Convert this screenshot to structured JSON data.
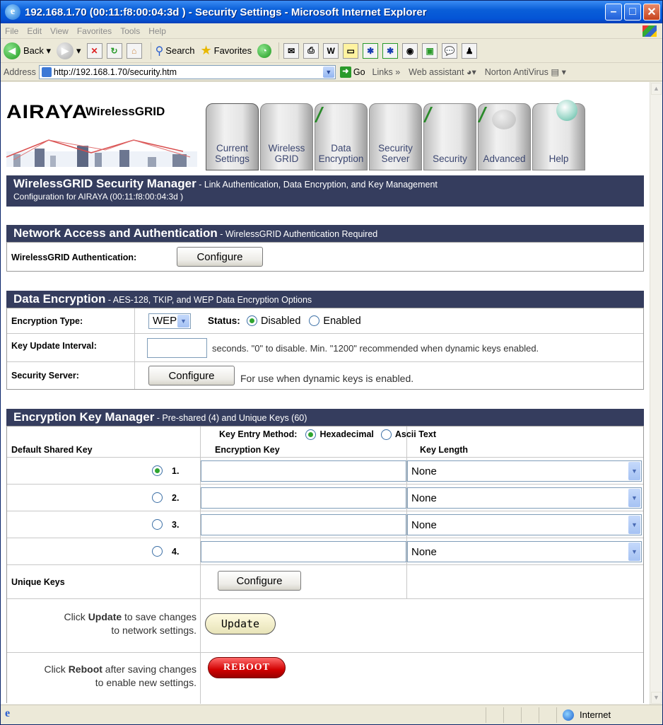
{
  "window": {
    "title": "192.168.1.70 (00:11:f8:00:04:3d ) - Security Settings - Microsoft Internet Explorer"
  },
  "menu": [
    "File",
    "Edit",
    "View",
    "Favorites",
    "Tools",
    "Help"
  ],
  "toolbar": {
    "back": "Back",
    "search": "Search",
    "favorites": "Favorites"
  },
  "addressbar": {
    "label": "Address",
    "url": "http://192.168.1.70/security.htm",
    "go": "Go",
    "links": "Links",
    "web_assistant": "Web assistant",
    "norton": "Norton AntiVirus"
  },
  "logo": {
    "brand": "AIRAYA",
    "product": "WirelessGRID"
  },
  "tabs": [
    {
      "line1": "Current",
      "line2": "Settings"
    },
    {
      "line1": "Wireless",
      "line2": "GRID"
    },
    {
      "line1": "Data",
      "line2": "Encryption"
    },
    {
      "line1": "Security",
      "line2": "Server"
    },
    {
      "line1": "",
      "line2": "Security"
    },
    {
      "line1": "",
      "line2": "Advanced"
    },
    {
      "line1": "",
      "line2": "Help"
    }
  ],
  "banner": {
    "title": "WirelessGRID Security Manager",
    "subtitle": " - Link Authentication, Data Encryption, and Key Management",
    "config": "Configuration for AIRAYA (00:11:f8:00:04:3d )"
  },
  "network_access": {
    "title": "Network Access and Authentication",
    "subtitle": " - WirelessGRID Authentication Required",
    "auth_label": "WirelessGRID Authentication:",
    "configure": "Configure"
  },
  "data_encryption": {
    "title": "Data Encryption",
    "subtitle": " - AES-128, TKIP, and WEP Data Encryption Options",
    "enc_type_label": "Encryption Type:",
    "enc_type_value": "WEP",
    "status_label": "Status:",
    "disabled": "Disabled",
    "enabled": "Enabled",
    "key_update_label": "Key Update Interval:",
    "key_update_value": "",
    "key_update_hint": "seconds. \"0\" to disable. Min. \"1200\" recommended when dynamic keys enabled.",
    "security_server_label": "Security Server:",
    "configure": "Configure",
    "security_server_hint": "For use when dynamic keys is enabled."
  },
  "key_manager": {
    "title": "Encryption Key Manager",
    "subtitle": " - Pre-shared (4) and Unique Keys (60)",
    "entry_method_label": "Key Entry Method:",
    "hex": "Hexadecimal",
    "ascii": "Ascii Text",
    "col_default": "Default Shared Key",
    "col_key": "Encryption Key",
    "col_length": "Key Length",
    "keys": [
      {
        "num": "1.",
        "selected": true,
        "value": "",
        "length": "None"
      },
      {
        "num": "2.",
        "selected": false,
        "value": "",
        "length": "None"
      },
      {
        "num": "3.",
        "selected": false,
        "value": "",
        "length": "None"
      },
      {
        "num": "4.",
        "selected": false,
        "value": "",
        "length": "None"
      }
    ],
    "unique_label": "Unique Keys",
    "configure": "Configure",
    "update_pre": "Click ",
    "update_bold": "Update",
    "update_post": " to save changes",
    "update_line2": "to network settings.",
    "update_btn": "Update",
    "reboot_pre": "Click ",
    "reboot_bold": "Reboot",
    "reboot_post": " after saving changes",
    "reboot_line2": "to enable new settings.",
    "reboot_btn": "REBOOT"
  },
  "statusbar": {
    "zone": "Internet"
  }
}
